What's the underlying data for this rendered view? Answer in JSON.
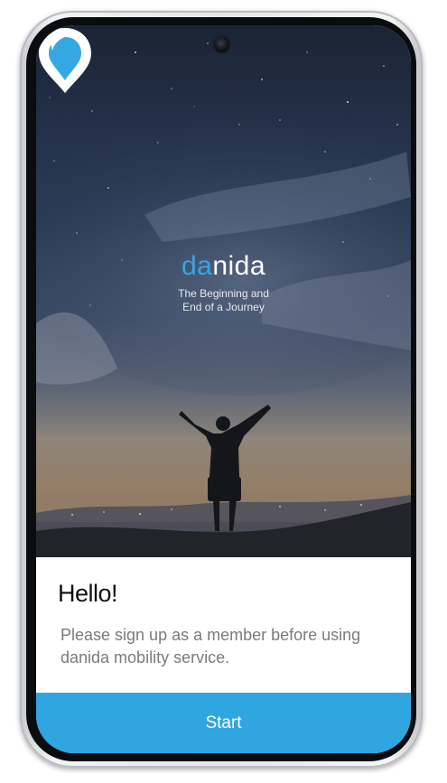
{
  "hero": {
    "brand_part_a": "da",
    "brand_part_b": "nida",
    "tagline_line1": "The Beginning and",
    "tagline_line2": "End of a Journey",
    "logo_icon": "location-pin-icon"
  },
  "card": {
    "greeting": "Hello!",
    "message": "Please sign up as a member before using danida mobility service."
  },
  "actions": {
    "start_label": "Start"
  },
  "colors": {
    "accent": "#2fa6e0",
    "brand_blue": "#35a7e3"
  }
}
